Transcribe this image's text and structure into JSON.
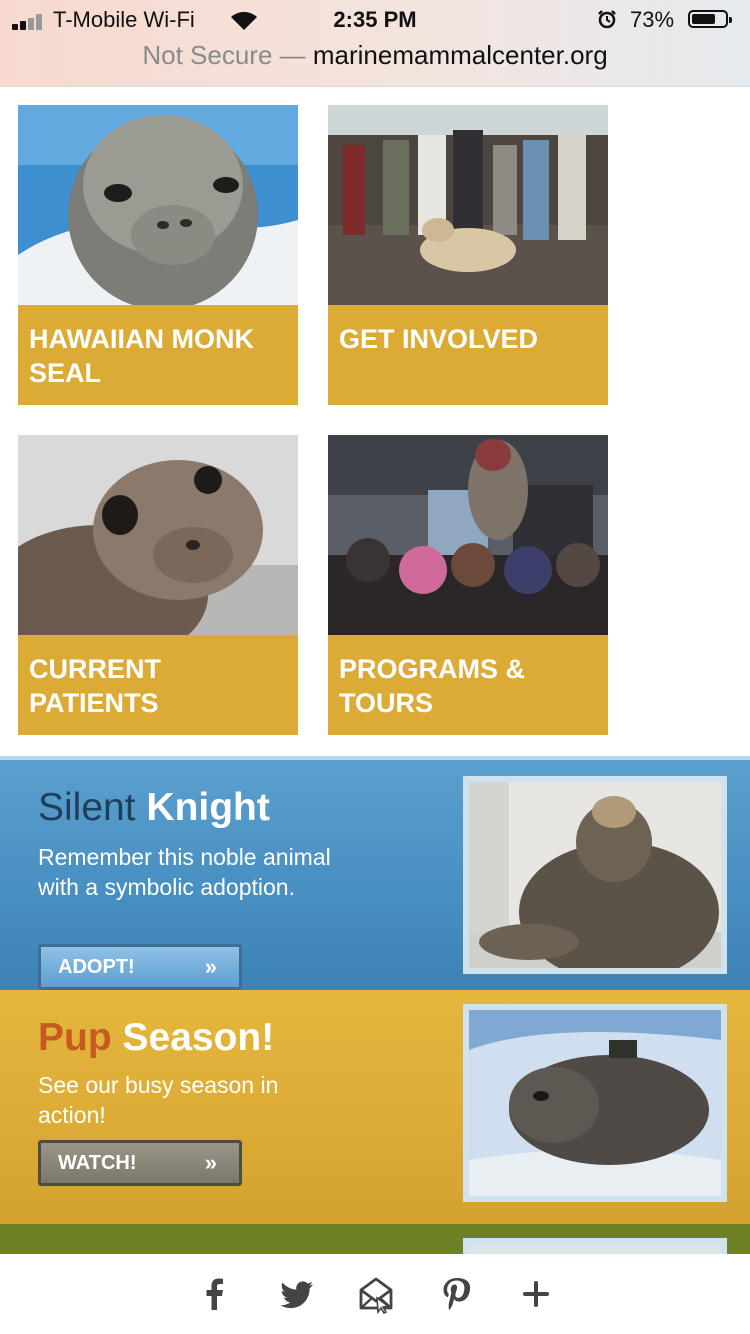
{
  "status_bar": {
    "carrier": "T-Mobile Wi-Fi",
    "time": "2:35 PM",
    "battery_pct": "73%",
    "battery_level": 0.73
  },
  "address_bar": {
    "security": "Not Secure",
    "separator": " — ",
    "domain": "marinemammalcenter.org"
  },
  "tiles": [
    {
      "label": "HAWAIIAN MONK SEAL"
    },
    {
      "label": "GET INVOLVED"
    },
    {
      "label": "CURRENT PATIENTS"
    },
    {
      "label": "PROGRAMS & TOURS"
    }
  ],
  "promos": {
    "adopt": {
      "title_part1": "Silent",
      "title_part2": "Knight",
      "text": "Remember this noble animal with a symbolic adoption.",
      "button": "ADOPT!",
      "button_chevron": "»"
    },
    "pup": {
      "title_part1": "Pup",
      "title_part2": "Season!",
      "text": "See our busy season in action!",
      "button": "WATCH!",
      "button_chevron": "»"
    }
  },
  "share_bar": {
    "icons": [
      "facebook-icon",
      "twitter-icon",
      "email-icon",
      "pinterest-icon",
      "plus-icon"
    ]
  },
  "colors": {
    "tile_band": "#dcab35",
    "promo_blue": "#4a91c4",
    "promo_gold": "#dcab35",
    "promo_green": "#6e8125",
    "orange_title": "#c65a22"
  }
}
